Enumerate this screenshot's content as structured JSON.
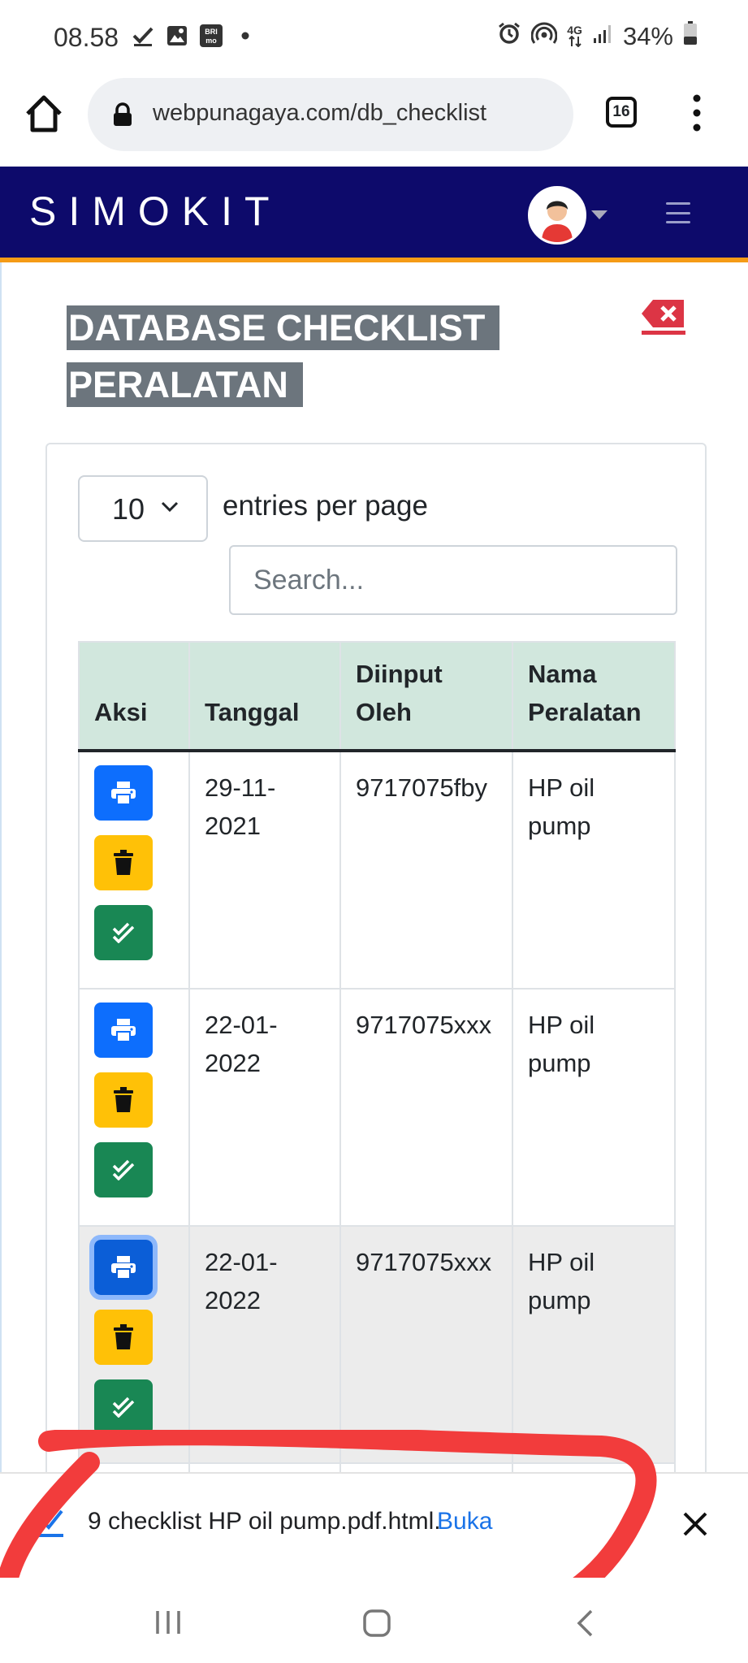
{
  "status_bar": {
    "time": "08.58",
    "notification_icons": [
      "check-icon",
      "image-icon",
      "brimo-icon",
      "dot-icon"
    ],
    "brimo_label": "BRI mo",
    "right_icons": [
      "alarm-icon",
      "hotspot-icon",
      "4g-icon",
      "signal-icon",
      "battery-icon"
    ],
    "network": "4G",
    "battery": "34%"
  },
  "browser": {
    "url": "webpunagaya.com/db_checklist",
    "tab_count": "16"
  },
  "app": {
    "brand": "SIMOKIT",
    "header_color": "#0d0a6b",
    "accent_color": "#f59b16"
  },
  "page": {
    "title_line1": "DATABASE CHECKLIST",
    "title_line2": "PERALATAN"
  },
  "table_controls": {
    "entries_value": "10",
    "entries_label": "entries per page",
    "search_placeholder": "Search..."
  },
  "table": {
    "headers": [
      "Aksi",
      "Tanggal",
      "Diinput Oleh",
      "Nama Peralatan"
    ],
    "rows": [
      {
        "tanggal": "29-11-2021",
        "diinput_oleh": "9717075fby",
        "nama_peralatan": "HP oil pump"
      },
      {
        "tanggal": "22-01-2022",
        "diinput_oleh": "9717075xxx",
        "nama_peralatan": "HP oil pump"
      },
      {
        "tanggal": "22-01-2022",
        "diinput_oleh": "9717075xxx",
        "nama_peralatan": "HP oil pump"
      }
    ],
    "button_colors": {
      "print": "#0d6efd",
      "delete": "#ffc107",
      "check": "#198754"
    }
  },
  "download_bar": {
    "filename": "9 checklist HP oil pump.pdf.html.",
    "open_label": "Buka"
  }
}
